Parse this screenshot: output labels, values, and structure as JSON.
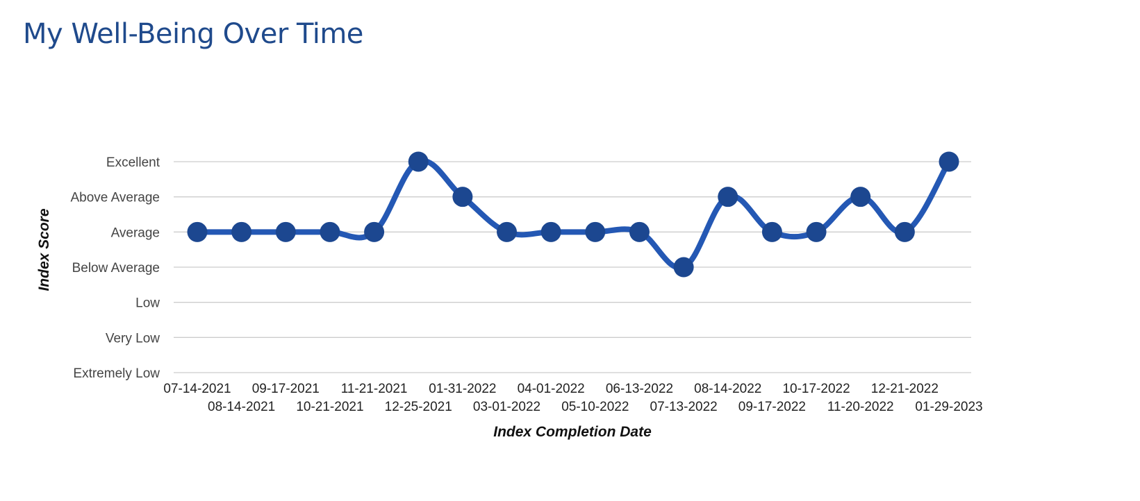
{
  "page": {
    "title": "My Well-Being Over Time"
  },
  "chart_data": {
    "type": "line",
    "title": "My Well-Being Over Time",
    "xlabel": "Index Completion Date",
    "ylabel": "Index Score",
    "y_categories": [
      "Extremely Low",
      "Very Low",
      "Low",
      "Below Average",
      "Average",
      "Above Average",
      "Excellent"
    ],
    "ylim": [
      0,
      6
    ],
    "grid": true,
    "smooth": true,
    "colors": {
      "line": "#2458b4",
      "marker": "#1c4790",
      "grid": "#cccccc",
      "title": "#1f4a8c"
    },
    "x": [
      "07-14-2021",
      "08-14-2021",
      "09-17-2021",
      "10-21-2021",
      "11-21-2021",
      "12-25-2021",
      "01-31-2022",
      "03-01-2022",
      "04-01-2022",
      "05-10-2022",
      "06-13-2022",
      "07-13-2022",
      "08-14-2022",
      "09-17-2022",
      "10-17-2022",
      "11-20-2022",
      "12-21-2022",
      "01-29-2023"
    ],
    "series": [
      {
        "name": "Index Score",
        "values": [
          4,
          4,
          4,
          4,
          4,
          6,
          5,
          4,
          4,
          4,
          4,
          3,
          5,
          4,
          4,
          5,
          4,
          6
        ],
        "labels": [
          "Average",
          "Average",
          "Average",
          "Average",
          "Average",
          "Excellent",
          "Above Average",
          "Average",
          "Average",
          "Average",
          "Average",
          "Below Average",
          "Above Average",
          "Average",
          "Average",
          "Above Average",
          "Average",
          "Excellent"
        ]
      }
    ]
  }
}
